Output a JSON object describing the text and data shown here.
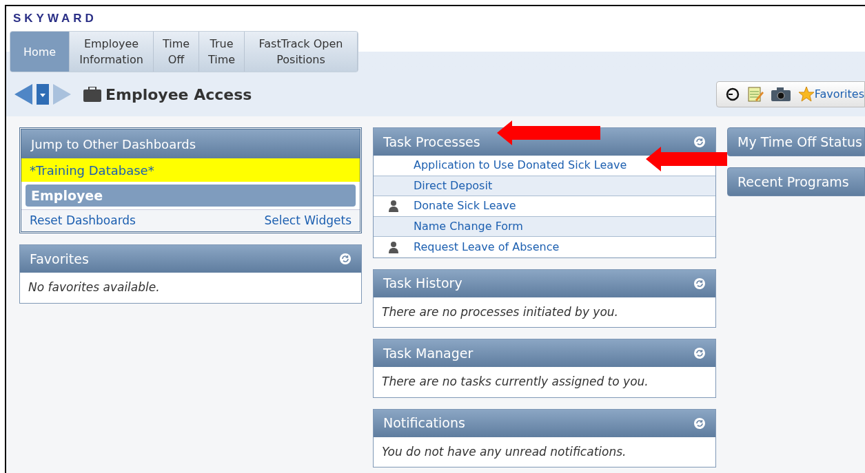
{
  "logo": "SKYWARD",
  "nav_tabs": [
    {
      "label": "Home",
      "selected": true
    },
    {
      "label": "Employee Information",
      "selected": false
    },
    {
      "label": "Time Off",
      "selected": false
    },
    {
      "label": "True Time",
      "selected": false
    },
    {
      "label": "FastTrack Open Positions",
      "selected": false
    }
  ],
  "page_title": "Employee Access",
  "toolbar": {
    "favorites": "Favorites"
  },
  "jump_panel": {
    "title": "Jump to Other Dashboards",
    "items": [
      {
        "label": "*Training Database*",
        "kind": "highlight"
      },
      {
        "label": "Employee",
        "kind": "current"
      }
    ],
    "links": [
      "Reset Dashboards",
      "Select Widgets"
    ]
  },
  "favorites_panel": {
    "title": "Favorites",
    "message": "No favorites available."
  },
  "task_processes": {
    "title": "Task Processes",
    "rows": [
      {
        "label": "Application to Use Donated Sick Leave",
        "person": false
      },
      {
        "label": "Direct Deposit",
        "person": false
      },
      {
        "label": "Donate Sick Leave",
        "person": true
      },
      {
        "label": "Name Change Form",
        "person": false
      },
      {
        "label": "Request Leave of Absence",
        "person": true
      }
    ]
  },
  "panels": [
    {
      "title": "Task History",
      "message": "There are no processes initiated by you."
    },
    {
      "title": "Task Manager",
      "message": "There are no tasks currently assigned to you."
    },
    {
      "title": "Notifications",
      "message": "You do not have any unread notifications."
    }
  ],
  "right_panels": [
    "My Time Off Status",
    "Recent Programs"
  ]
}
